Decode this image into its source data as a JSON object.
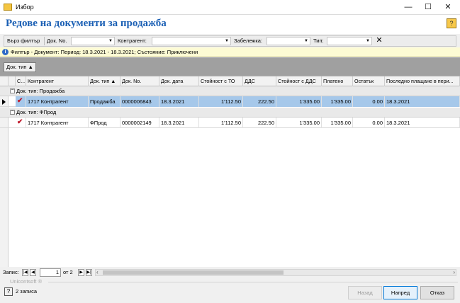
{
  "window": {
    "title": "Избор"
  },
  "header": {
    "title": "Редове на документи за продажба"
  },
  "filter": {
    "quick_filter_label": "Бърз филтър",
    "doc_no_label": "Док. No.",
    "counterparty_label": "Контрагент:",
    "note_label": "Забележка:",
    "type_label": "Тип:"
  },
  "info": {
    "text": "Филтър - Документ: Период: 18.3.2021 - 18.3.2021; Състояние: Приключени"
  },
  "grouping": {
    "chip_label": "Док. тип ▲"
  },
  "grid": {
    "columns": [
      "С...",
      "Контрагент",
      "Док. тип ▲",
      "Док. No.",
      "Док. дата",
      "Стойност с ТО",
      "ДДС",
      "Стойност с ДДС",
      "Платено",
      "Остатък",
      "Последно плащане в пери..."
    ],
    "groups": [
      {
        "label": "Док. тип: Продажба",
        "rows": [
          {
            "checked": true,
            "counterparty": "1717 Контрагент",
            "doc_type": "Продажба",
            "doc_no": "0000006843",
            "doc_date": "18.3.2021",
            "value_to": "1'112.50",
            "vat": "222.50",
            "value_vat": "1'335.00",
            "paid": "1'335.00",
            "balance": "0.00",
            "last_payment": "18.3.2021"
          }
        ]
      },
      {
        "label": "Док. тип: ФПрод",
        "rows": [
          {
            "checked": true,
            "counterparty": "1717 Контрагент",
            "doc_type": "ФПрод",
            "doc_no": "0000002149",
            "doc_date": "18.3.2021",
            "value_to": "1'112.50",
            "vat": "222.50",
            "value_vat": "1'335.00",
            "paid": "1'335.00",
            "balance": "0.00",
            "last_payment": "18.3.2021"
          }
        ]
      }
    ]
  },
  "navigator": {
    "label": "Запис:",
    "current": "1",
    "total": "от 2"
  },
  "footer": {
    "brand": "Unicontsoft ®",
    "status": "2 записа",
    "back_label": "Назад",
    "next_label": "Напред",
    "cancel_label": "Отказ"
  }
}
